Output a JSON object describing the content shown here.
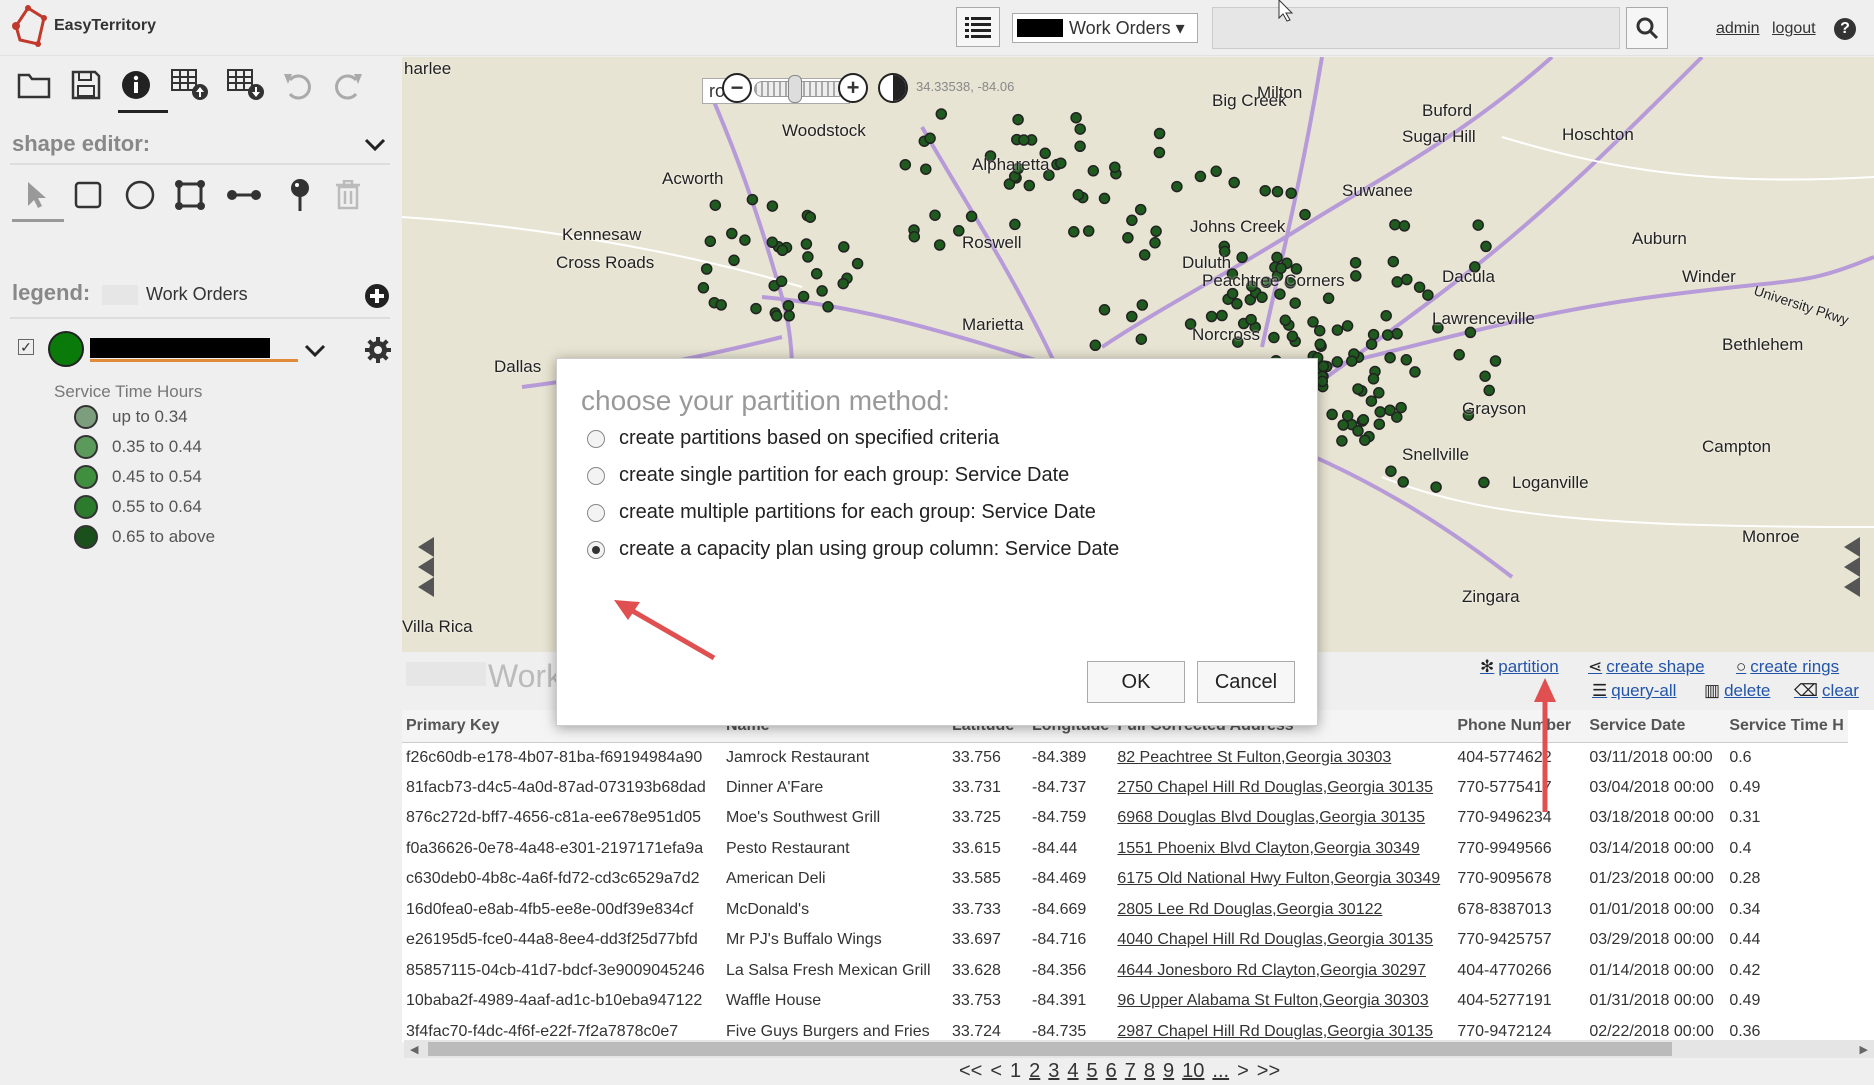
{
  "app": {
    "name": "EasyTerritory"
  },
  "header": {
    "layer_select": "Work Orders ▾",
    "user_link": "admin",
    "logout_link": "logout",
    "help": "?"
  },
  "shape_editor": {
    "title": "shape editor:"
  },
  "legend": {
    "title": "legend:",
    "layer_name": "Work Orders",
    "group_title": "Service Time Hours",
    "entries": [
      {
        "label": "up to 0.34",
        "color": "#7d9e7d"
      },
      {
        "label": "0.35 to 0.44",
        "color": "#5c9a5c"
      },
      {
        "label": "0.45 to 0.54",
        "color": "#3f8f3f"
      },
      {
        "label": "0.55 to 0.64",
        "color": "#2c7a2c"
      },
      {
        "label": "0.65 to above",
        "color": "#1b4f1b"
      }
    ]
  },
  "map": {
    "road_select": "road",
    "coords": "34.33538, -84.06"
  },
  "towns": [
    {
      "name": "Big Creek"
    },
    {
      "name": "Buford"
    },
    {
      "name": "Sugar Hill"
    },
    {
      "name": "Hoschton"
    },
    {
      "name": "Woodstock"
    },
    {
      "name": "Acworth"
    },
    {
      "name": "Alpharetta"
    },
    {
      "name": "Suwanee"
    },
    {
      "name": "Kennesaw"
    },
    {
      "name": "Roswell"
    },
    {
      "name": "Johns Creek"
    },
    {
      "name": "Duluth"
    },
    {
      "name": "Auburn"
    },
    {
      "name": "Cross Roads"
    },
    {
      "name": "Peachtree Corners"
    },
    {
      "name": "Dacula"
    },
    {
      "name": "Winder"
    },
    {
      "name": "University Pkwy"
    },
    {
      "name": "Lawrenceville"
    },
    {
      "name": "Bethlehem"
    },
    {
      "name": "Norcross"
    },
    {
      "name": "Dallas"
    },
    {
      "name": "Grayson"
    },
    {
      "name": "Campton"
    },
    {
      "name": "Snellville"
    },
    {
      "name": "Loganville"
    },
    {
      "name": "Monroe"
    },
    {
      "name": "Zingara"
    },
    {
      "name": "Villa Rica"
    },
    {
      "name": "Marietta"
    },
    {
      "name": "Milton"
    },
    {
      "name": "harlee"
    }
  ],
  "dock": {
    "title": "Work"
  },
  "actions": {
    "partition": "partition",
    "create_shape": "create shape",
    "create_rings": "create rings",
    "query_all": "query-all",
    "delete": "delete",
    "clear": "clear"
  },
  "table": {
    "columns": [
      "Primary Key",
      "Name",
      "Latitude",
      "Longitude",
      "Full Corrected Address",
      "Phone Number",
      "Service Date",
      "Service Time H"
    ],
    "rows": [
      [
        "f26c60db-e178-4b07-81ba-f69194984a90",
        "Jamrock Restaurant",
        "33.756",
        "-84.389",
        "82 Peachtree St Fulton,Georgia 30303",
        "404-5774622",
        "03/11/2018 00:00",
        "0.6"
      ],
      [
        "81facb73-d4c5-4a0d-87ad-073193b68dad",
        "Dinner A'Fare",
        "33.731",
        "-84.737",
        "2750 Chapel Hill Rd Douglas,Georgia 30135",
        "770-5775417",
        "03/04/2018 00:00",
        "0.49"
      ],
      [
        "876c272d-bff7-4656-c81a-ee678e951d05",
        "Moe's Southwest Grill",
        "33.725",
        "-84.759",
        "6968 Douglas Blvd Douglas,Georgia 30135",
        "770-9496234",
        "03/18/2018 00:00",
        "0.31"
      ],
      [
        "f0a36626-0e78-4a48-e301-2197171efa9a",
        "Pesto Restaurant",
        "33.615",
        "-84.44",
        "1551 Phoenix Blvd Clayton,Georgia 30349",
        "770-9949566",
        "03/14/2018 00:00",
        "0.4"
      ],
      [
        "c630deb0-4b8c-4a6f-fd72-cd3c6529a7d2",
        "American Deli",
        "33.585",
        "-84.469",
        "6175 Old National Hwy Fulton,Georgia 30349",
        "770-9095678",
        "01/23/2018 00:00",
        "0.28"
      ],
      [
        "16d0fea0-e8ab-4fb5-ee8e-00df39e834cf",
        "McDonald's",
        "33.733",
        "-84.669",
        "2805 Lee Rd Douglas,Georgia 30122",
        "678-8387013",
        "01/01/2018 00:00",
        "0.34"
      ],
      [
        "e26195d5-fce0-44a8-8ee4-dd3f25d77bfd",
        "Mr PJ's Buffalo Wings",
        "33.697",
        "-84.716",
        "4040 Chapel Hill Rd Douglas,Georgia 30135",
        "770-9425757",
        "03/29/2018 00:00",
        "0.44"
      ],
      [
        "85857115-04cb-41d7-bdcf-3e9009045246",
        "La Salsa Fresh Mexican Grill",
        "33.628",
        "-84.356",
        "4644 Jonesboro Rd Clayton,Georgia 30297",
        "404-4770266",
        "01/14/2018 00:00",
        "0.42"
      ],
      [
        "10baba2f-4989-4aaf-ad1c-b10eba947122",
        "Waffle House",
        "33.753",
        "-84.391",
        "96 Upper Alabama St Fulton,Georgia 30303",
        "404-5277191",
        "01/31/2018 00:00",
        "0.49"
      ],
      [
        "3f4fac70-f4dc-4f6f-e22f-7f2a7878c0e7",
        "Five Guys Burgers and Fries",
        "33.724",
        "-84.735",
        "2987 Chapel Hill Rd Douglas,Georgia 30135",
        "770-9472124",
        "02/22/2018 00:00",
        "0.36"
      ]
    ]
  },
  "pager": {
    "first": "<<",
    "prev": "<",
    "pages": [
      "1",
      "2",
      "3",
      "4",
      "5",
      "6",
      "7",
      "8",
      "9",
      "10"
    ],
    "ellipsis": "...",
    "next": ">",
    "last": ">>"
  },
  "dialog": {
    "title": "choose your partition method:",
    "options": [
      {
        "label": "create partitions based on specified criteria",
        "selected": false
      },
      {
        "label": "create single partition for each group: Service Date",
        "selected": false
      },
      {
        "label": "create multiple partitions for each group: Service Date",
        "selected": false
      },
      {
        "label": "create a capacity plan using group column: Service Date",
        "selected": true
      }
    ],
    "ok": "OK",
    "cancel": "Cancel"
  },
  "colors": {
    "accent": "#e05050",
    "link": "#2255aa",
    "point": "#1f5a1f"
  }
}
